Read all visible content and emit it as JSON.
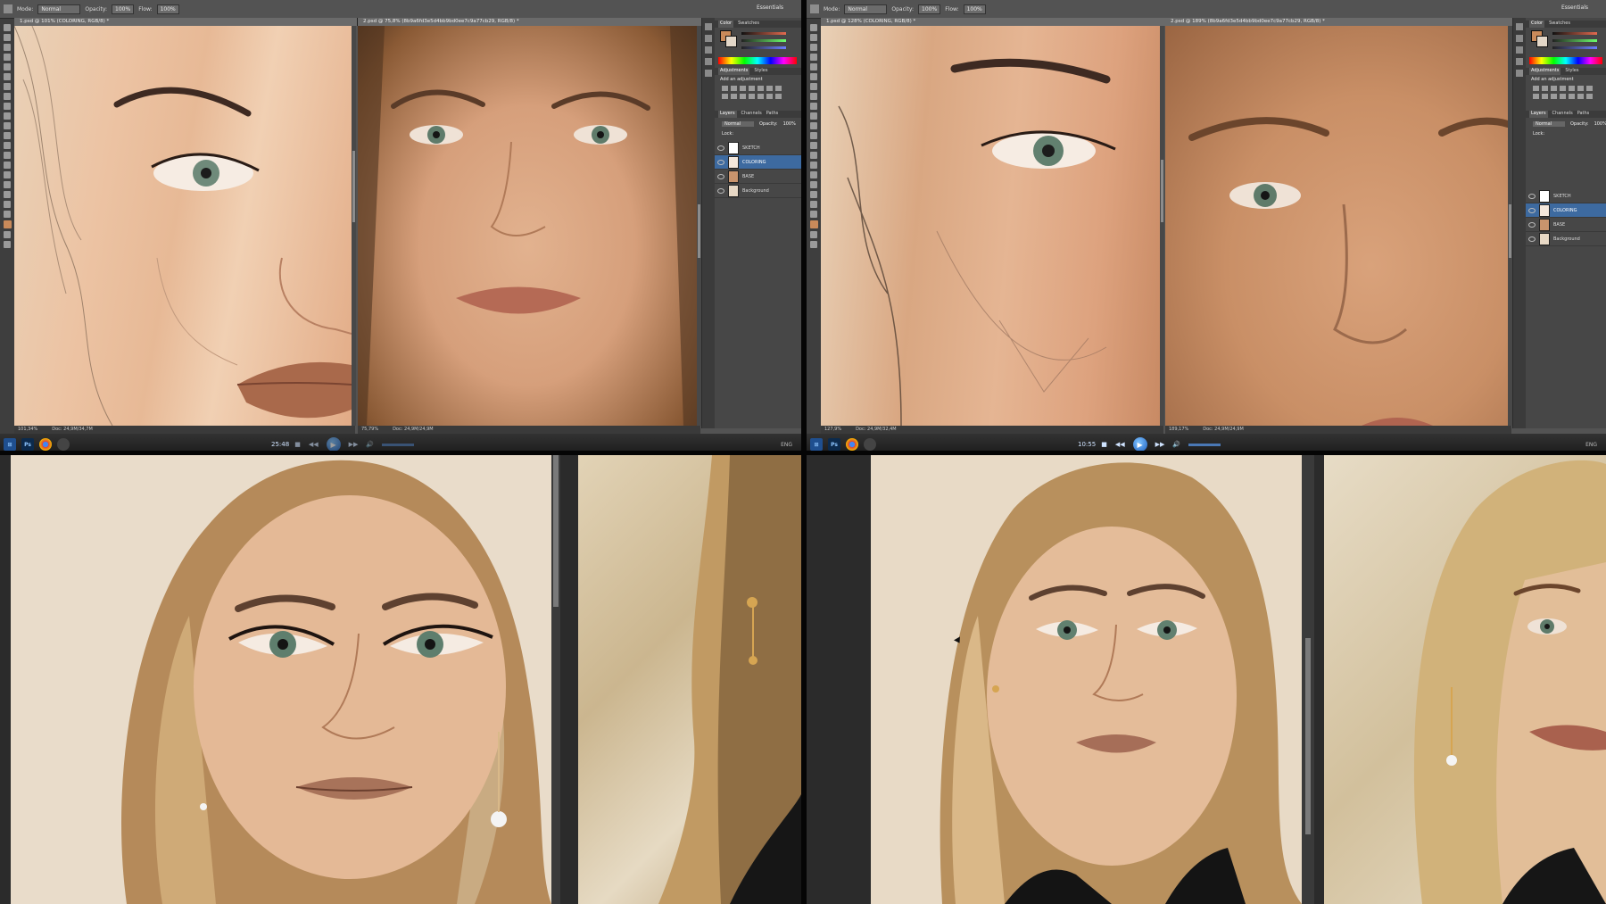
{
  "ps": {
    "options_bar": {
      "mode_label": "Mode:",
      "mode_value": "Normal",
      "opacity_label": "Opacity:",
      "opacity_value": "100%",
      "flow_label": "Flow:",
      "flow_value": "100%",
      "workspace": "Essentials"
    },
    "panels": {
      "color_tab": "Color",
      "swatches_tab": "Swatches",
      "adjustments_tab": "Adjustments",
      "styles_tab": "Styles",
      "add_adjustment": "Add an adjustment",
      "layers_tab": "Layers",
      "channels_tab": "Channels",
      "paths_tab": "Paths",
      "blend_mode": "Normal",
      "opacity_label": "Opacity:",
      "opacity_value": "100%",
      "lock_label": "Lock:"
    },
    "layers": [
      {
        "name": "SKETCH"
      },
      {
        "name": "COLORING"
      },
      {
        "name": "BASE"
      },
      {
        "name": "Background"
      }
    ]
  },
  "windows": [
    {
      "tabs": [
        "1.psd @ 101% (COLORING, RGB/8) *",
        "2.psd @ 75,8% (8b9a6fd3e5d4bb9bd0ee7c9a77cb29, RGB/8) *"
      ],
      "status": [
        "101,34%",
        "Doc: 24,9M/34,7M",
        "75,79%",
        "Doc: 24,9M/24,9M"
      ],
      "time": "25:48",
      "taskbar_lang": "ENG"
    },
    {
      "tabs": [
        "1.psd @ 128% (COLORING, RGB/8) *",
        "2.psd @ 189% (8b9a6fd3e5d4bb9bd0ee7c9a77cb29, RGB/8) *"
      ],
      "status": [
        "127,9%",
        "Doc: 24,9M/32,4M",
        "189,17%",
        "Doc: 24,9M/24,9M"
      ],
      "time": "10:55",
      "taskbar_lang": "ENG"
    }
  ],
  "icons": [
    "eye-icon",
    "play-icon",
    "stop-icon",
    "rewind-icon",
    "forward-icon",
    "volume-icon",
    "windows-start-icon",
    "photoshop-icon",
    "chrome-icon"
  ]
}
